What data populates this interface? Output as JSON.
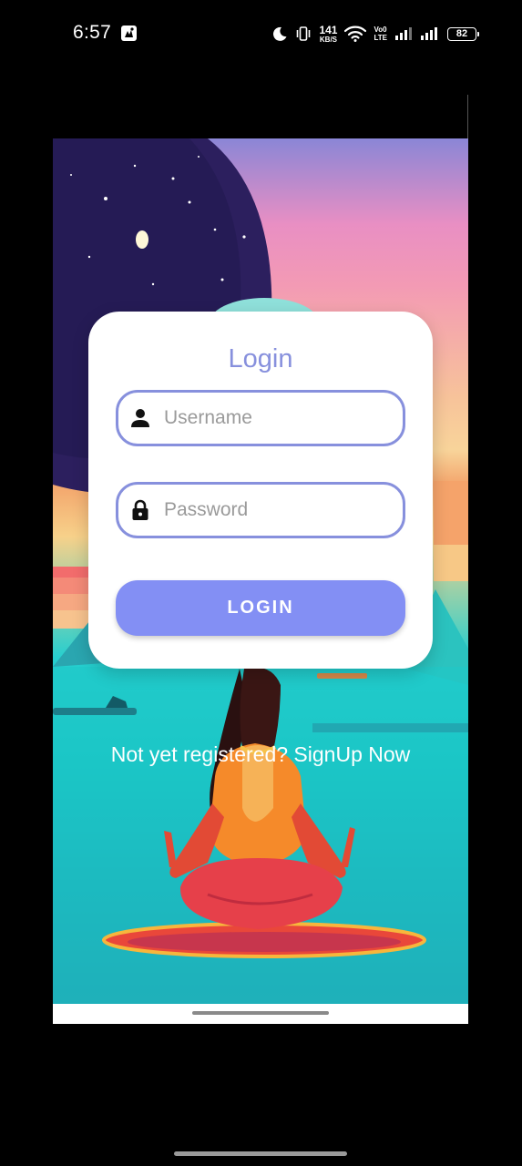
{
  "status_bar": {
    "time": "6:57",
    "net_speed_value": "141",
    "net_speed_unit": "KB/S",
    "volte_line1": "Vo0",
    "volte_line2": "LTE",
    "battery": "82",
    "icons": [
      "app-notification-icon",
      "do-not-disturb-moon-icon",
      "vibrate-icon",
      "wifi-icon",
      "signal-bars-icon",
      "battery-icon"
    ]
  },
  "login": {
    "title": "Login",
    "username_placeholder": "Username",
    "username_value": "",
    "password_placeholder": "Password",
    "password_value": "",
    "button_label": "LOGIN",
    "signup_text": "Not yet registered? SignUp Now"
  },
  "colors": {
    "accent": "#8790dd",
    "button": "#838ff4",
    "card": "#ffffff"
  },
  "icons": {
    "username": "person-icon",
    "password": "lock-icon"
  }
}
